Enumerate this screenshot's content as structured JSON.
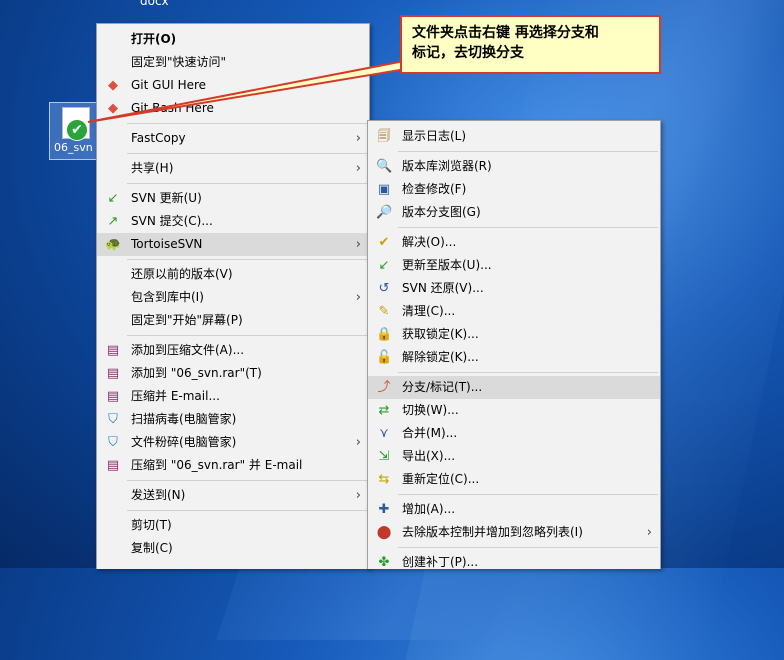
{
  "desktop": {
    "top_label": "docx",
    "icon_label": "06_svn"
  },
  "callout": {
    "line1": "文件夹点击右键 再选择分支和",
    "line2": "标记，去切换分支"
  },
  "main_menu": {
    "items": [
      {
        "label": "打开(O)",
        "icon": "none"
      },
      {
        "label": "固定到\"快速访问\"",
        "icon": "none"
      },
      {
        "label": "Git GUI Here",
        "icon": "git-icon"
      },
      {
        "label": "Git Bash Here",
        "icon": "git-icon"
      },
      {
        "label": "FastCopy",
        "icon": "none"
      },
      {
        "label": "共享(H)",
        "icon": "none"
      },
      {
        "label": "SVN 更新(U)",
        "icon": "svn-update-icon"
      },
      {
        "label": "SVN 提交(C)...",
        "icon": "svn-commit-icon"
      },
      {
        "label": "TortoiseSVN",
        "icon": "tortoise-icon"
      },
      {
        "label": "还原以前的版本(V)",
        "icon": "none"
      },
      {
        "label": "包含到库中(I)",
        "icon": "none"
      },
      {
        "label": "固定到\"开始\"屏幕(P)",
        "icon": "none"
      },
      {
        "label": "添加到压缩文件(A)...",
        "icon": "winrar-icon"
      },
      {
        "label": "添加到 \"06_svn.rar\"(T)",
        "icon": "winrar-icon"
      },
      {
        "label": "压缩并 E-mail...",
        "icon": "winrar-icon"
      },
      {
        "label": "扫描病毒(电脑管家)",
        "icon": "shield-icon"
      },
      {
        "label": "文件粉碎(电脑管家)",
        "icon": "shield-icon"
      },
      {
        "label": "压缩到 \"06_svn.rar\" 并 E-mail",
        "icon": "winrar-icon"
      },
      {
        "label": "发送到(N)",
        "icon": "none"
      },
      {
        "label": "剪切(T)",
        "icon": "none"
      },
      {
        "label": "复制(C)",
        "icon": "none"
      }
    ]
  },
  "sub_menu": {
    "items": [
      {
        "label": "显示日志(L)"
      },
      {
        "label": "版本库浏览器(R)"
      },
      {
        "label": "检查修改(F)"
      },
      {
        "label": "版本分支图(G)"
      },
      {
        "label": "解决(O)..."
      },
      {
        "label": "更新至版本(U)..."
      },
      {
        "label": "SVN 还原(V)..."
      },
      {
        "label": "清理(C)..."
      },
      {
        "label": "获取锁定(K)..."
      },
      {
        "label": "解除锁定(K)..."
      },
      {
        "label": "分支/标记(T)..."
      },
      {
        "label": "切换(W)..."
      },
      {
        "label": "合并(M)..."
      },
      {
        "label": "导出(X)..."
      },
      {
        "label": "重新定位(C)..."
      },
      {
        "label": "增加(A)..."
      },
      {
        "label": "去除版本控制并增加到忽略列表(I)"
      },
      {
        "label": "创建补丁(P)..."
      }
    ]
  }
}
